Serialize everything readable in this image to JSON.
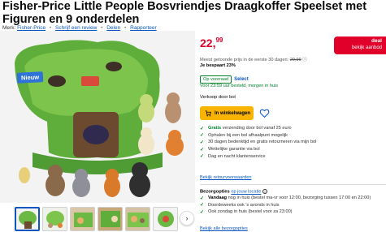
{
  "product": {
    "title": "Fisher-Price Little People Bosvriendjes Draagkoffer Speelset met Figuren en 9 onderdelen",
    "brand_label": "Merk:",
    "brand": "Fisher-Price",
    "write_review": "Schrijf een review",
    "share": "Delen",
    "report": "Rapporteer"
  },
  "hero": {
    "badge": "Nieuw"
  },
  "gallery": {
    "thumb_count": 6,
    "active_index": 0,
    "next_label": "›"
  },
  "offer": {
    "price_whole": "22,",
    "price_cents": "99",
    "deal_label": "deal",
    "deal_sub": "bekijk aanbod",
    "measured_prefix": "Meest getoonde prijs in de eerste 30 dagen:",
    "measured_price": "29,99",
    "savings": "Je bespaart 23%",
    "stock": "Op voorraad",
    "select": "Select",
    "delivery": "Voor 23:59 uur besteld, morgen in huis",
    "seller": "Verkoop door bol",
    "cart_button": "In winkelwagen",
    "usps": [
      {
        "strong": "Gratis",
        "text": " verzending door bol vanaf 25 euro"
      },
      {
        "strong": "",
        "text": "Ophalen bij een bol afhaalpunt mogelijk"
      },
      {
        "strong": "",
        "text": "30 dagen bedenktijd en gratis retourneren via mijn bol"
      },
      {
        "strong": "",
        "text": "Wettelijke garantie via bol"
      },
      {
        "strong": "",
        "text": "Dag en nacht klantenservice"
      }
    ],
    "return_link": "Bekijk retourvoorwaarden",
    "bezorg_title": "Bezorgopties",
    "bezorg_location": "op jouw locatie",
    "bezorg": [
      {
        "strong": "Vandaag",
        "text": " nog in huis (bestel ma-vr voor 12:00, bezorging tussen 17:00 en 22:00)"
      },
      {
        "strong": "",
        "text": "Doordeweeks ook 's avonds in huis"
      },
      {
        "strong": "",
        "text": "Ook zondag in huis (bestel voor za 23:00)"
      }
    ],
    "bezorg_link": "Bekijk alle bezorgopties"
  },
  "colors": {
    "brand_blue": "#0a57c2",
    "price_red": "#e0002a",
    "cart_yellow": "#f8b400",
    "stock_green": "#00822b"
  }
}
